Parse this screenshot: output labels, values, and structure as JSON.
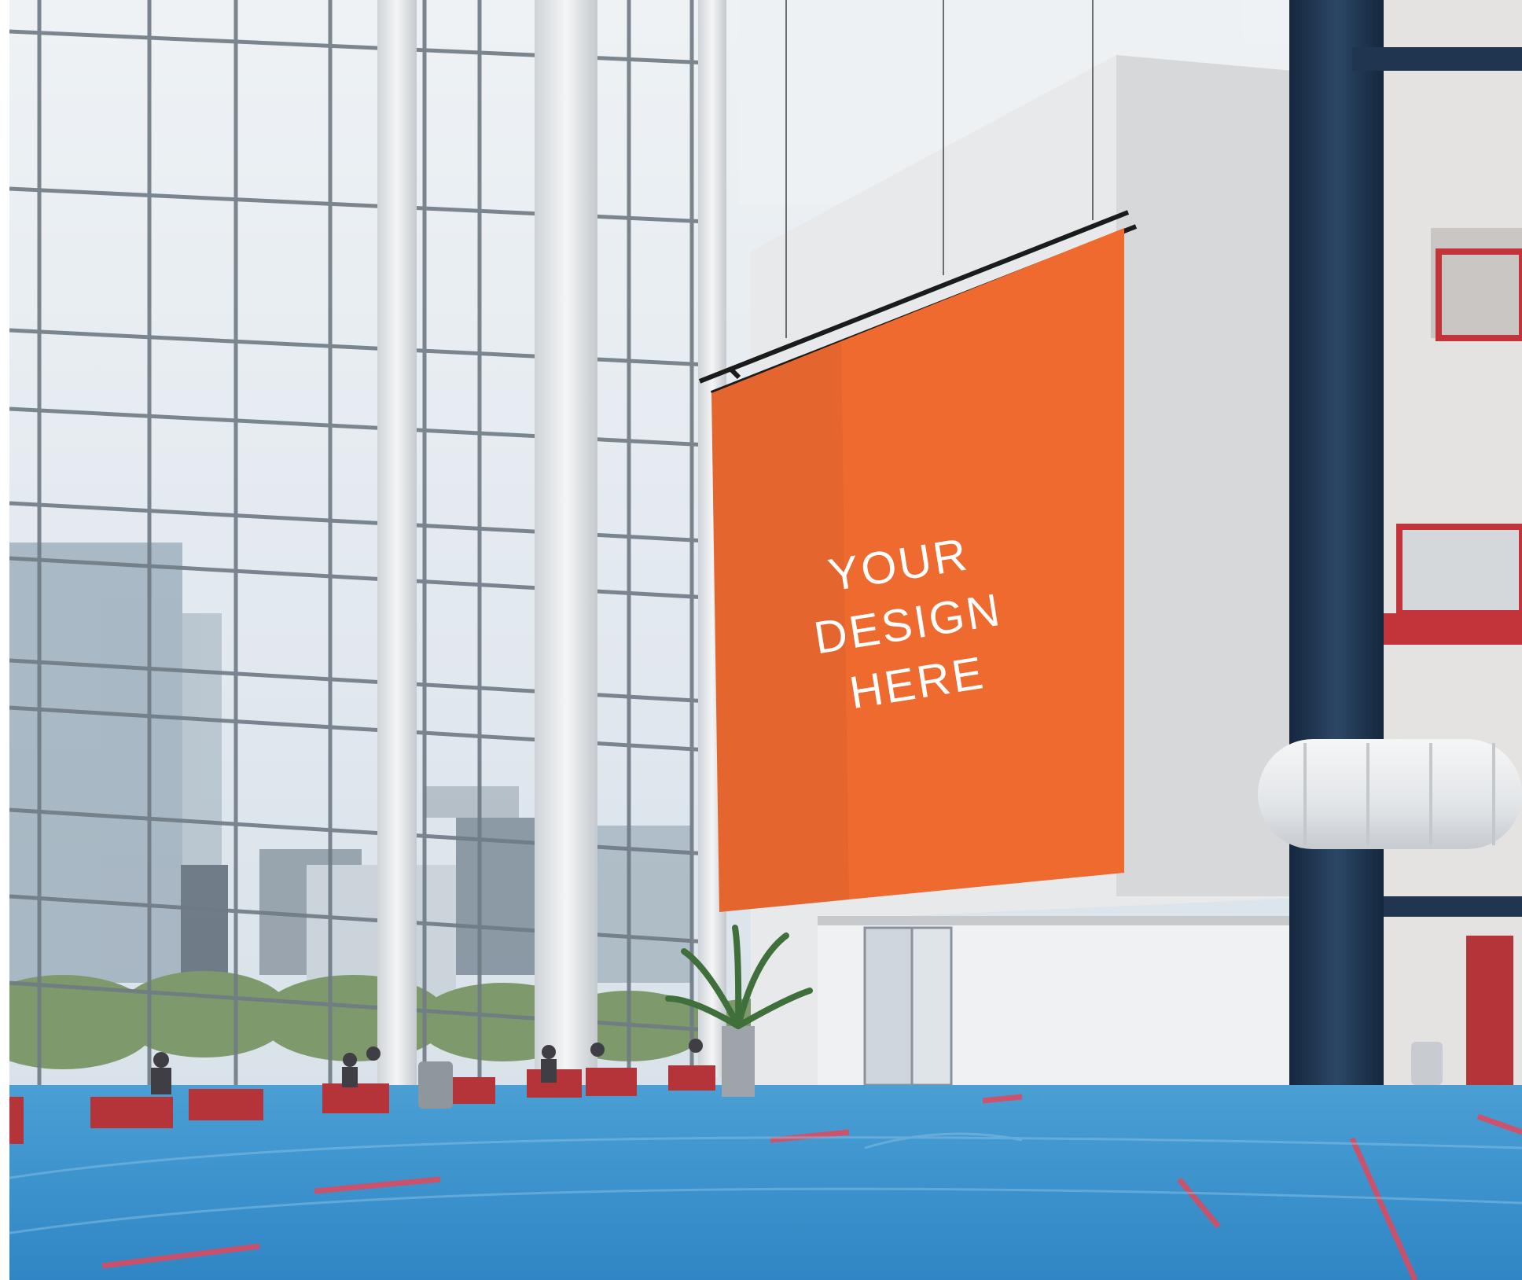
{
  "banner": {
    "line1": "YOUR DESIGN",
    "line2": "HERE",
    "color": "#ee6a2f",
    "text_color": "#ffffff"
  },
  "palette": {
    "carpet": "#3f93cc",
    "carpet_stripe": "#e4475a",
    "column": "#1f3550",
    "wall": "#e9eaea",
    "glass": "#d7e1ea",
    "seating": "#b4343a"
  }
}
